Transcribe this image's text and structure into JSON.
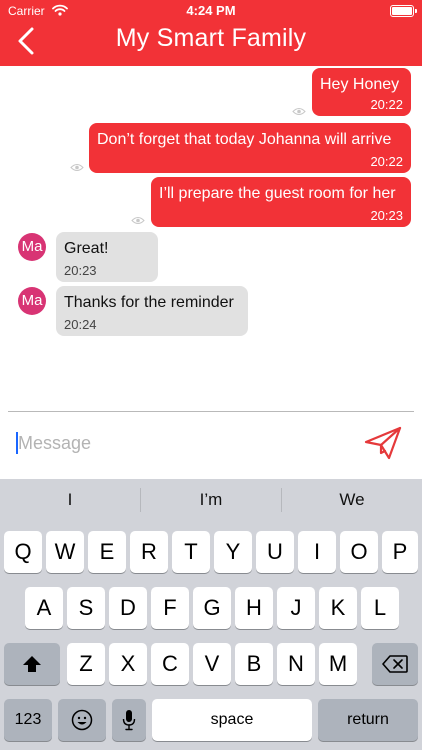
{
  "status_bar": {
    "carrier": "Carrier",
    "time": "4:24 PM"
  },
  "header": {
    "title": "My Smart Family",
    "back_icon": "chevron-left-icon"
  },
  "messages": [
    {
      "direction": "outgoing",
      "text": "Hey Honey",
      "time": "20:22",
      "status": "seen"
    },
    {
      "direction": "outgoing",
      "text": "Don’t forget that today Johanna will arrive",
      "time": "20:22",
      "status": "seen"
    },
    {
      "direction": "outgoing",
      "text": "I’ll prepare the guest room for her",
      "time": "20:23",
      "status": "seen"
    },
    {
      "direction": "incoming",
      "sender_initials": "Ma",
      "text": "Great!",
      "time": "20:23"
    },
    {
      "direction": "incoming",
      "sender_initials": "Ma",
      "text": "Thanks for the reminder",
      "time": "20:24"
    }
  ],
  "composer": {
    "placeholder": "Message",
    "value": "",
    "send_icon": "paper-plane-icon"
  },
  "keyboard": {
    "suggestions": [
      "I",
      "I’m",
      "We"
    ],
    "row1": [
      "Q",
      "W",
      "E",
      "R",
      "T",
      "Y",
      "U",
      "I",
      "O",
      "P"
    ],
    "row2": [
      "A",
      "S",
      "D",
      "F",
      "G",
      "H",
      "J",
      "K",
      "L"
    ],
    "row3": [
      "Z",
      "X",
      "C",
      "V",
      "B",
      "N",
      "M"
    ],
    "numbers_label": "123",
    "space_label": "space",
    "return_label": "return"
  },
  "colors": {
    "brand": "#f23237",
    "incoming_bubble": "#e1e1e1",
    "avatar": "#d83474",
    "keyboard_bg": "#d1d3d9"
  }
}
